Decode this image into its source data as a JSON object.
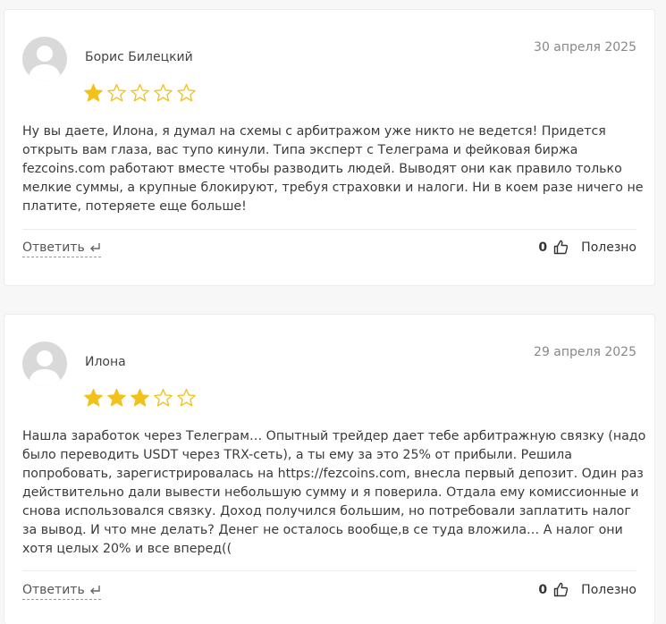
{
  "colors": {
    "star_filled": "#f2c21b",
    "star_empty": "#f2c21b",
    "avatar_bg": "#d9d9d9"
  },
  "reviews": [
    {
      "author": "Борис Билецкий",
      "date": "30 апреля 2025",
      "rating": 1,
      "rating_max": 5,
      "text": "Ну вы даете, Илона, я думал на схемы с арбитражом уже никто не ведется! Придется открыть вам глаза, вас тупо кинули. Типа эксперт с Телеграма и фейковая биржа fezcoins.com работают вместе чтобы разводить людей. Выводят они как правило только мелкие суммы, а крупные блокируют, требуя страховки и налоги. Ни в коем разе ничего не платите, потеряете еще больше!",
      "reply_label": "Ответить",
      "helpful_count": "0",
      "helpful_label": "Полезно"
    },
    {
      "author": "Илона",
      "date": "29 апреля 2025",
      "rating": 3,
      "rating_max": 5,
      "text": "Нашла заработок через Телеграм… Опытный трейдер дает тебе арбитражную связку (надо было переводить USDT через TRX-сеть), а ты ему за это 25% от прибыли. Решила попробовать, зарегистрировалась на https://fezcoins.com, внесла первый депозит. Один раз действительно дали вывести небольшую сумму и я поверила. Отдала ему комиссионные и снова использовался связку. Доход получился большим, но потребовали заплатить налог за вывод. И что мне делать? Денег не осталось вообще,в се туда вложила… А налог они хотя целых 20% и все вперед((",
      "reply_label": "Ответить",
      "helpful_count": "0",
      "helpful_label": "Полезно"
    }
  ]
}
